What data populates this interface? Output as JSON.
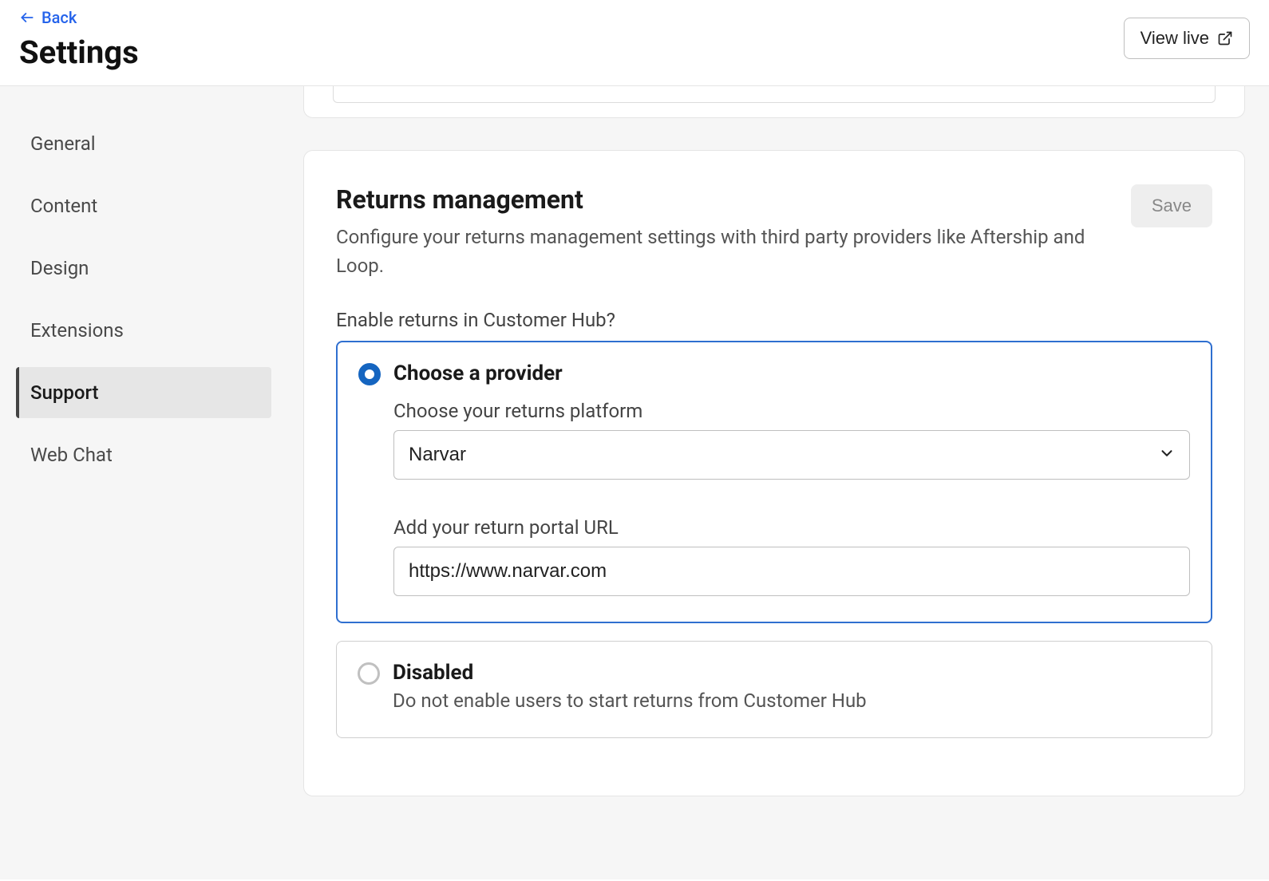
{
  "header": {
    "back_label": "Back",
    "title": "Settings",
    "view_live_label": "View live"
  },
  "sidebar": {
    "items": [
      {
        "label": "General",
        "active": false
      },
      {
        "label": "Content",
        "active": false
      },
      {
        "label": "Design",
        "active": false
      },
      {
        "label": "Extensions",
        "active": false
      },
      {
        "label": "Support",
        "active": true
      },
      {
        "label": "Web Chat",
        "active": false
      }
    ]
  },
  "returns": {
    "title": "Returns management",
    "description": "Configure your returns management settings with third party providers like Aftership and Loop.",
    "save_label": "Save",
    "enable_question": "Enable returns in Customer Hub?",
    "option_provider": {
      "title": "Choose a provider",
      "platform_label": "Choose your returns platform",
      "platform_value": "Narvar",
      "url_label": "Add your return portal URL",
      "url_value": "https://www.narvar.com"
    },
    "option_disabled": {
      "title": "Disabled",
      "subtitle": "Do not enable users to start returns from Customer Hub"
    }
  }
}
